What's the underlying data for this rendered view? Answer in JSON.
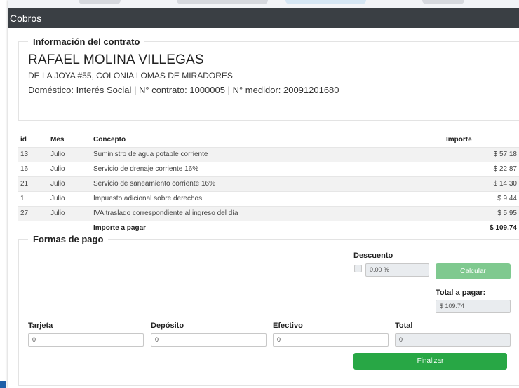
{
  "window": {
    "title": "Cobros"
  },
  "contract": {
    "legend": "Información del contrato",
    "client_name": "RAFAEL MOLINA VILLEGAS",
    "address": "DE LA JOYA #55, COLONIA LOMAS DE MIRADORES",
    "details": "Doméstico: Interés Social | N° contrato: 1000005 | N° medidor: 20091201680"
  },
  "charges": {
    "headers": {
      "id": "id",
      "month": "Mes",
      "concept": "Concepto",
      "amount": "Importe"
    },
    "rows": [
      {
        "id": "13",
        "month": "Julio",
        "concept": "Suministro de agua potable corriente",
        "amount": "$ 57.18"
      },
      {
        "id": "16",
        "month": "Julio",
        "concept": "Servicio de drenaje corriente 16%",
        "amount": "$ 22.87"
      },
      {
        "id": "21",
        "month": "Julio",
        "concept": "Servicio de saneamiento corriente 16%",
        "amount": "$ 14.30"
      },
      {
        "id": "1",
        "month": "Julio",
        "concept": "Impuesto adicional sobre derechos",
        "amount": "$ 9.44"
      },
      {
        "id": "27",
        "month": "Julio",
        "concept": "IVA traslado correspondiente al ingreso del día",
        "amount": "$ 5.95"
      }
    ],
    "total_label": "Importe a pagar",
    "total_value": "$ 109.74"
  },
  "payment": {
    "legend": "Formas de pago",
    "discount_label": "Descuento",
    "discount_value": "0.00 %",
    "calc_button": "Calcular",
    "total_to_pay_label": "Total a pagar:",
    "total_to_pay_value": "$ 109.74",
    "card_label": "Tarjeta",
    "card_value": "0",
    "deposit_label": "Depósito",
    "deposit_value": "0",
    "cash_label": "Efectivo",
    "cash_value": "0",
    "total_label": "Total",
    "total_value": "0",
    "finish_button": "Finalizar"
  },
  "colors": {
    "titlebar": "#3a3f44",
    "finish_button": "#28a745",
    "calc_button": "#7fc98f",
    "left_accent": "#1e5fa8"
  }
}
